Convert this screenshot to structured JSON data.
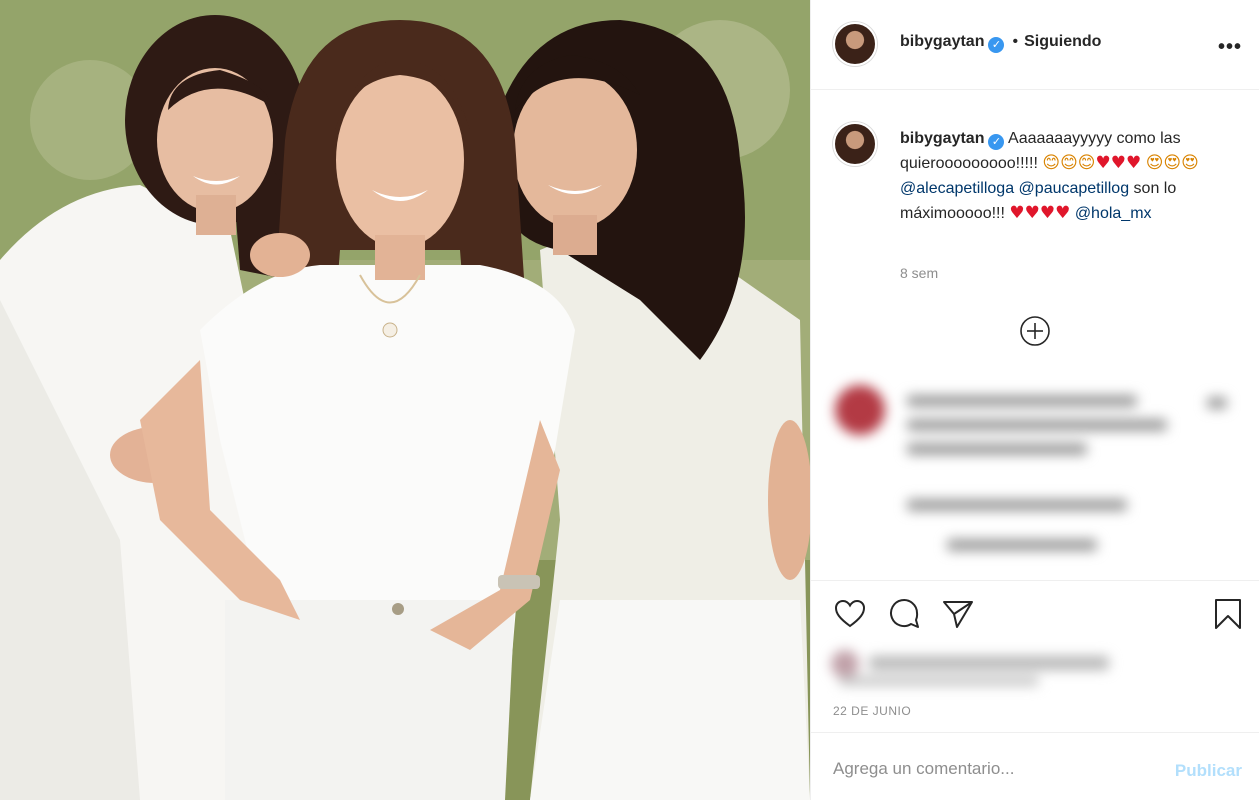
{
  "post": {
    "username": "bibygaytan",
    "follow_status": "Siguiendo",
    "separator": "•",
    "verified_glyph": "✓",
    "more_glyph": "•••"
  },
  "caption": {
    "username": "bibygaytan",
    "text_1": "Aaaaaaayyyyy como las quierooooooooo!!!!!",
    "emoji_smiles": "😊😊😊",
    "emoji_hearts_1": "♥♥♥",
    "emoji_hearts_eyes": "😍😍😍",
    "mention_1": "@alecapetilloga",
    "mention_2": "@paucapetillog",
    "text_2": "son lo máximooooo!!!",
    "emoji_hearts_2": "♥♥♥♥",
    "mention_3": "@hola_mx",
    "time": "8 sem"
  },
  "footer": {
    "date": "22 DE JUNIO",
    "comment_placeholder": "Agrega un comentario...",
    "publish_label": "Publicar"
  },
  "icons": {
    "like": "heart-icon",
    "comment": "comment-icon",
    "share": "send-icon",
    "save": "bookmark-icon",
    "load_more": "plus-circle-icon"
  },
  "colors": {
    "link": "#00376b",
    "verified": "#3897f0",
    "publish_disabled": "#b2dffc",
    "secondary_text": "#8e8e8e"
  }
}
